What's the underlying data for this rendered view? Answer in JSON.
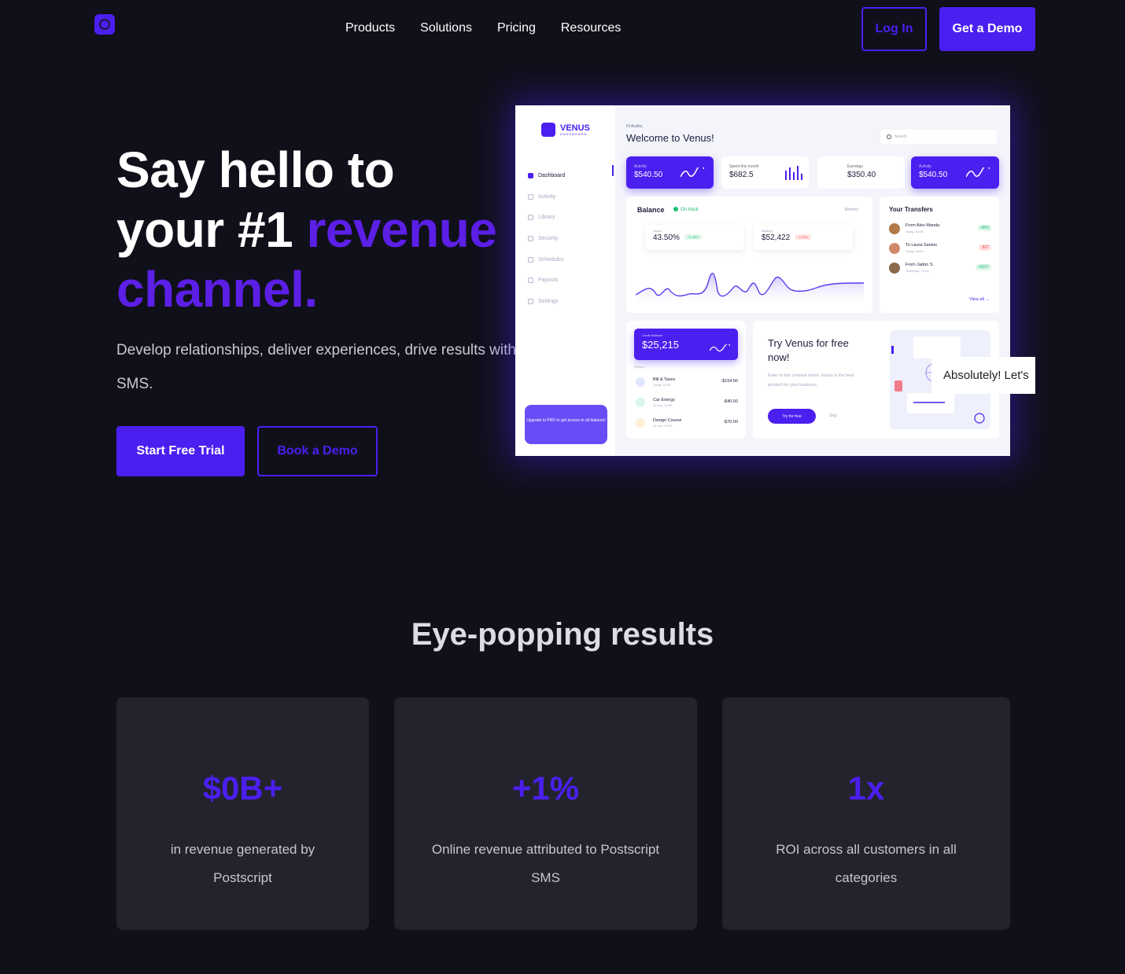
{
  "nav": {
    "links": [
      "Products",
      "Solutions",
      "Pricing",
      "Resources"
    ],
    "login": "Log In",
    "demo": "Get a Demo"
  },
  "hero": {
    "title_line1": "Say hello to",
    "title_line2a": "your #1 ",
    "title_line2b": "revenue",
    "title_line3": "channel.",
    "subtitle": "Develop relationships, deliver experiences, drive results with SMS.",
    "primary_cta": "Start Free Trial",
    "secondary_cta": "Book a Demo"
  },
  "dashboard": {
    "brand": "VENUS",
    "brand_sub": "DASHBOARD",
    "menu": [
      "Dashboard",
      "Activity",
      "Library",
      "Security",
      "Schedules",
      "Payouts",
      "Settings"
    ],
    "upgrade": "Upgrade to PRO to get access to all features!",
    "greeting": "Hi Andrei,",
    "welcome": "Welcome to Venus!",
    "search_placeholder": "Search",
    "stats": [
      {
        "label": "Activity",
        "value": "$540.50"
      },
      {
        "label": "Spent this month",
        "value": "$682.5"
      },
      {
        "label": "Earnings",
        "value": "$350.40"
      },
      {
        "label": "Activity",
        "value": "$540.50"
      }
    ],
    "balance": {
      "title": "Balance",
      "status": "On track",
      "period": "Monthly",
      "saves_label": "Saves",
      "saves_value": "43.50%",
      "saves_chip": "+2.45%",
      "balance_label": "Balance",
      "balance_value": "$52,422",
      "balance_chip": "-4.75%"
    },
    "transfers": {
      "title": "Your Transfers",
      "items": [
        {
          "name": "From Alex Manda",
          "time": "Today, 16:36",
          "amount": "+$50"
        },
        {
          "name": "To Laura Santos",
          "time": "Today, 08:49",
          "amount": "-$27"
        },
        {
          "name": "From Jadon S.",
          "time": "Yesterday, 14:36",
          "amount": "+$157"
        }
      ],
      "view_all": "View all"
    },
    "credit": {
      "label": "Credit Balance",
      "value": "$25,215",
      "recent": "Recent",
      "items": [
        {
          "name": "Bill & Taxes",
          "time": "Today, 16:36",
          "amount": "-$154.50"
        },
        {
          "name": "Car Energy",
          "time": "23 Jun, 13:06",
          "amount": "-$40.50"
        },
        {
          "name": "Design Course",
          "time": "21 Jun, 19:04",
          "amount": "-$70.00"
        }
      ]
    },
    "try": {
      "title": "Try Venus for free now!",
      "text": "Enter in this creative world. Venus is the best product for your business.",
      "button": "Try for free",
      "skip": "Skip"
    }
  },
  "tooltip": "Absolutely! Let's",
  "results": {
    "title": "Eye-popping results",
    "cards": [
      {
        "number": "$0B+",
        "desc": "in revenue generated by Postscript"
      },
      {
        "number": "+1%",
        "desc": "Online revenue attributed to Postscript SMS"
      },
      {
        "number": "1x",
        "desc": "ROI across all customers in all categories"
      }
    ]
  }
}
